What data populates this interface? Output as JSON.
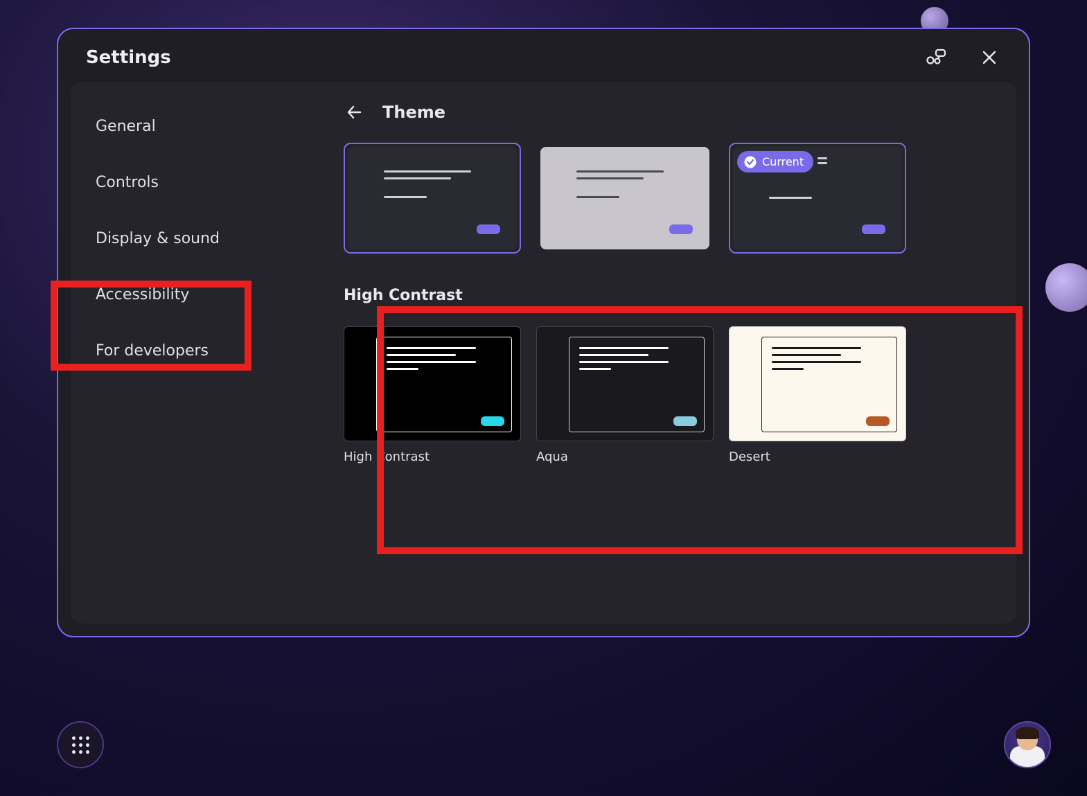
{
  "window": {
    "title": "Settings"
  },
  "sidebar": {
    "items": [
      "General",
      "Controls",
      "Display & sound",
      "Accessibility",
      "For developers"
    ]
  },
  "panel": {
    "title": "Theme",
    "current_badge": "Current",
    "hc_heading": "High Contrast",
    "hc_themes": [
      {
        "name": "High Contrast"
      },
      {
        "name": "Aqua"
      },
      {
        "name": "Desert"
      }
    ]
  }
}
